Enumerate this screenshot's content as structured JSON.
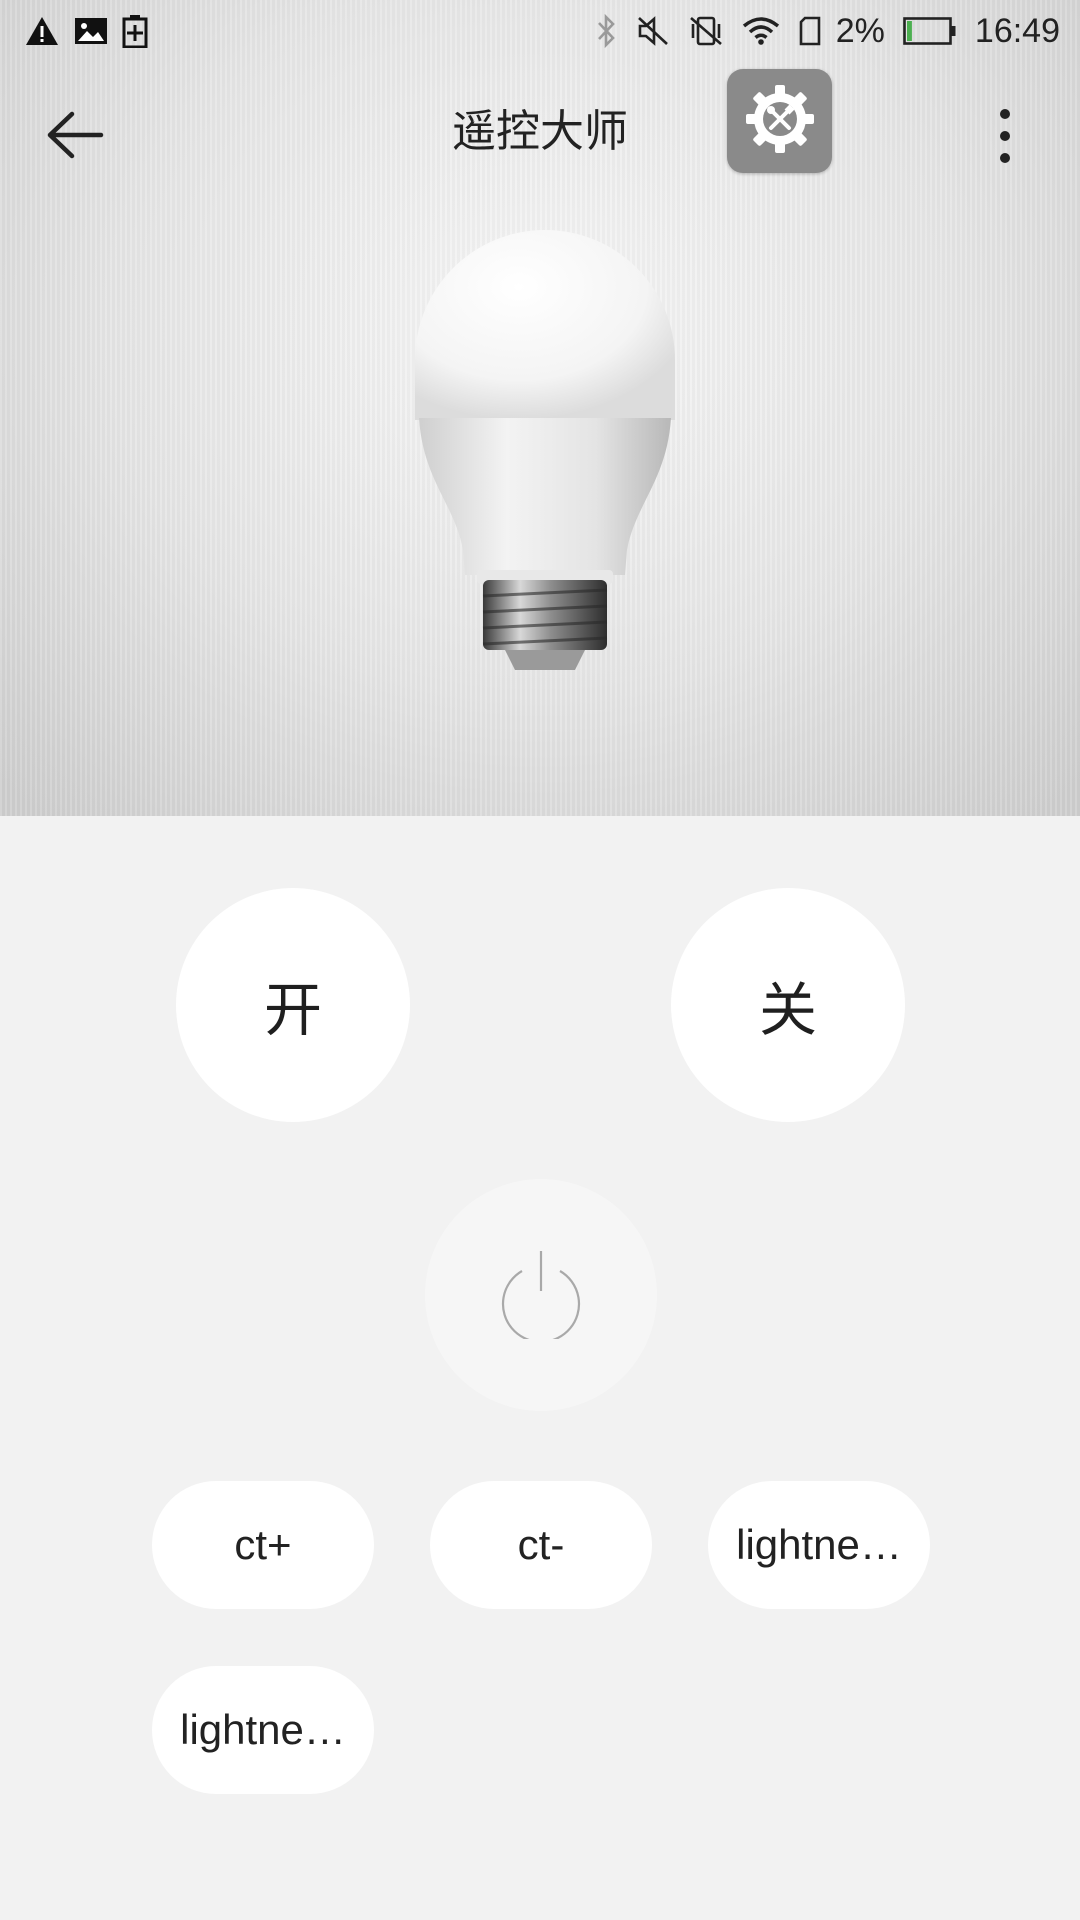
{
  "status_bar": {
    "left_icons": [
      "warning-icon",
      "image-icon",
      "battery-saver-icon"
    ],
    "right_icons": [
      "bluetooth-icon",
      "mute-icon",
      "vibrate-off-icon",
      "wifi-icon",
      "sim-icon"
    ],
    "battery_percent": "2%",
    "battery_level": 0.02,
    "battery_color": "#4caf50",
    "time": "16:49"
  },
  "app_bar": {
    "title": "遥控大师",
    "back_icon": "back-arrow-icon",
    "settings_icon": "settings-tools-icon",
    "more_icon": "more-vert-icon"
  },
  "device": {
    "image": "light-bulb"
  },
  "remote": {
    "on_label": "开",
    "off_label": "关",
    "power_icon": "power-icon",
    "buttons": [
      {
        "label": "ct+"
      },
      {
        "label": "ct-"
      },
      {
        "label": "lightne…"
      },
      {
        "label": "lightne…"
      }
    ]
  },
  "colors": {
    "panel_background": "#f2f2f2",
    "button_background": "#ffffff",
    "settings_button": "#8a8a8a"
  }
}
